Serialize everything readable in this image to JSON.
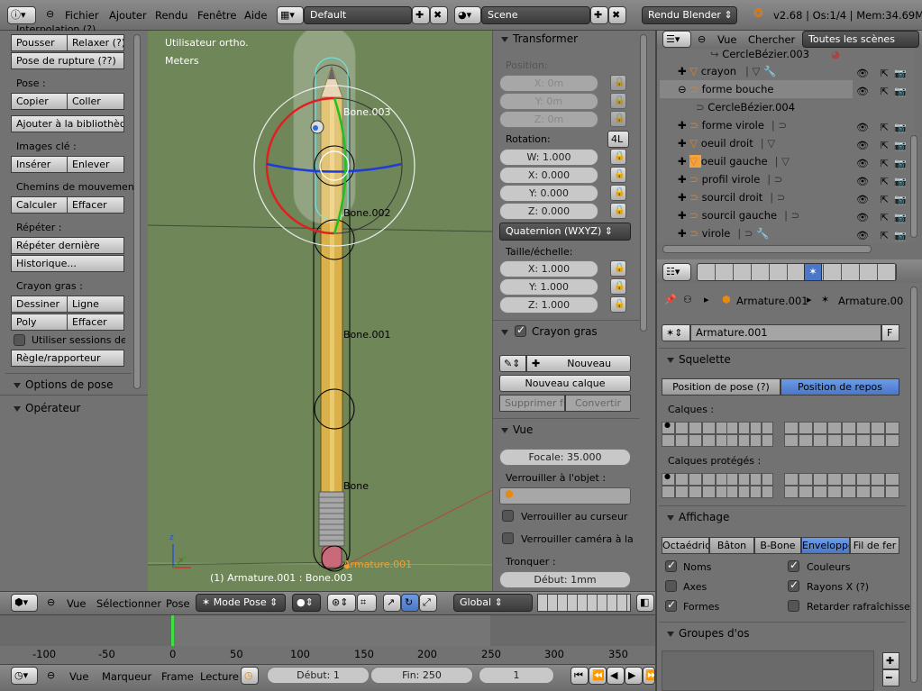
{
  "top_header": {
    "menus": [
      "Fichier",
      "Ajouter",
      "Rendu",
      "Fenêtre",
      "Aide"
    ],
    "layout_name": "Default",
    "scene_name": "Scene",
    "render_engine": "Rendu Blender",
    "stats": "v2.68 | Os:1/4 | Mem:34.69M ("
  },
  "left_panel": {
    "cut_top_label": "Interpolation (?)",
    "push_label": "Pousser",
    "relax_label": "Relaxer (?)",
    "breakdown_label": "Pose de rupture (??)",
    "pose_section": "Pose :",
    "copy_label": "Copier",
    "paste_label": "Coller",
    "add_library_label": "Ajouter à la bibliothèqu",
    "keyframes_section": "Images clé :",
    "insert_label": "Insérer",
    "remove_label": "Enlever",
    "motion_paths_section": "Chemins de mouvemen",
    "calculate_label": "Calculer",
    "clear_label": "Effacer",
    "repeat_section": "Répéter :",
    "repeat_last_label": "Répéter dernière",
    "history_label": "Historique...",
    "grease_section": "Crayon gras :",
    "draw_label": "Dessiner",
    "line_label": "Ligne",
    "poly_label": "Poly",
    "erase_label": "Effacer",
    "use_sessions_label": "Utiliser sessions de c",
    "ruler_label": "Règle/rapporteur",
    "pose_options_section": "Options de pose",
    "operator_section": "Opérateur"
  },
  "viewport": {
    "view_name": "Utilisateur ortho.",
    "units": "Meters",
    "bones": [
      "Bone.003",
      "Bone.002",
      "Bone.001",
      "Bone"
    ],
    "armature_label": "Armature.001",
    "status": "(1) Armature.001 : Bone.003"
  },
  "viewport_header": {
    "view_menu": "Vue",
    "select_menu": "Sélectionner",
    "pose_menu": "Pose",
    "mode": "Mode Pose",
    "orientation": "Global"
  },
  "properties_n": {
    "transform_section": "Transformer",
    "position_label": "Position:",
    "pos_x": "X: 0m",
    "pos_y": "Y: 0m",
    "pos_z": "Z: 0m",
    "rotation_label": "Rotation:",
    "rotation_mode_short": "4L",
    "rot_w": "W: 1.000",
    "rot_x": "X: 0.000",
    "rot_y": "Y: 0.000",
    "rot_z": "Z: 0.000",
    "rotation_mode": "Quaternion (WXYZ)",
    "scale_label": "Taille/échelle:",
    "scale_x": "X: 1.000",
    "scale_y": "Y: 1.000",
    "scale_z": "Z: 1.000",
    "grease_pencil_section": "Crayon gras",
    "new_label": "Nouveau",
    "new_layer_label": "Nouveau calque",
    "delete_frame_label": "Supprimer fra",
    "convert_label": "Convertir",
    "view_section": "Vue",
    "focal_label": "Focale: 35.000",
    "lock_object_label": "Verrouiller à l'objet :",
    "lock_cursor_label": "Verrouiller au curseur",
    "lock_camera_label": "Verrouiller caméra à la",
    "clip_label": "Tronquer :",
    "clip_start": "Début: 1mm"
  },
  "outliner": {
    "view_menu": "Vue",
    "search_menu": "Chercher",
    "scenes_dropdown": "Toutes les scènes",
    "rows": [
      "CercleBézier.003",
      "crayon",
      "forme bouche",
      "CercleBézier.004",
      "forme virole",
      "oeuil droit",
      "oeuil gauche",
      "profil virole",
      "sourcil droit",
      "sourcil gauche",
      "virole"
    ]
  },
  "properties": {
    "breadcrumb_1": "Armature.001",
    "breadcrumb_2": "Armature.00",
    "data_name": "Armature.001",
    "fake_user": "F",
    "skeleton_section": "Squelette",
    "pose_position": "Position de pose (?)",
    "rest_position": "Position de repos",
    "layers_label": "Calques :",
    "protected_layers_label": "Calques protégés :",
    "display_section": "Affichage",
    "display_types": [
      "Octaédriq",
      "Bâton",
      "B-Bone",
      "Enveloppe",
      "Fil de fer"
    ],
    "names_label": "Noms",
    "colors_label": "Couleurs",
    "axes_label": "Axes",
    "xray_label": "Rayons X (?)",
    "shapes_label": "Formes",
    "delay_label": "Retarder rafraîchisse",
    "bone_groups_section": "Groupes d'os"
  },
  "timeline": {
    "ticks": [
      "-100",
      "-50",
      "0",
      "50",
      "100",
      "150",
      "200",
      "250",
      "300",
      "350"
    ],
    "view_menu": "Vue",
    "marker_menu": "Marqueur",
    "frame_menu": "Frame",
    "playback_menu": "Lecture",
    "start": "Début: 1",
    "end": "Fin: 250",
    "current": "1"
  }
}
